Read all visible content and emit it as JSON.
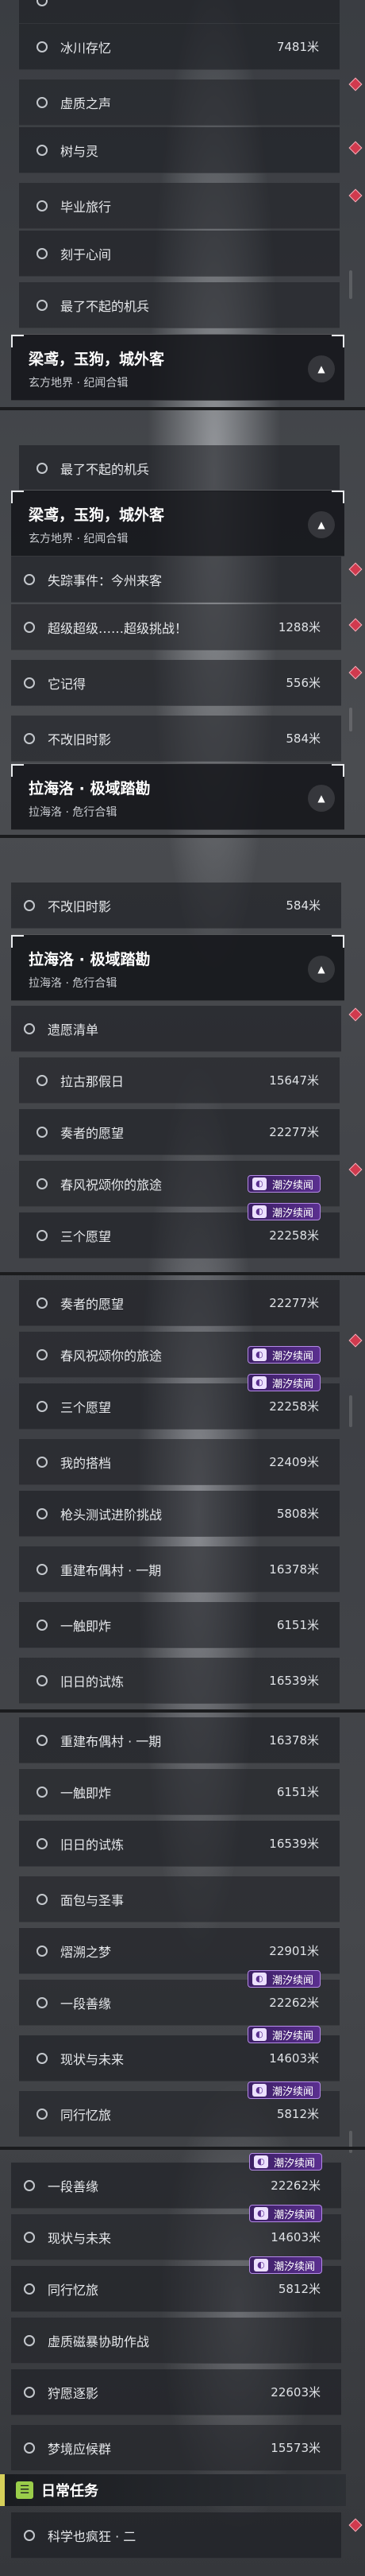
{
  "panels": [
    {
      "rows": [
        {
          "label": "",
          "circ": true,
          "dist": ""
        },
        {
          "label": "冰川存忆",
          "dist": "7481米"
        },
        {
          "label": "虚质之声",
          "dist": ""
        },
        {
          "label": "树与灵",
          "dist": ""
        },
        {
          "label": "毕业旅行",
          "dist": ""
        },
        {
          "label": "刻于心间",
          "dist": ""
        },
        {
          "label": "最了不起的机兵",
          "dist": ""
        }
      ],
      "header": {
        "title": "梁鸢，玉狗，城外客",
        "subtitle": "玄方地界 · 纪闻合辑"
      }
    },
    {
      "rows": [
        {
          "label": "最了不起的机兵",
          "dist": ""
        }
      ],
      "header": {
        "title": "梁鸢，玉狗，城外客",
        "subtitle": "玄方地界 · 纪闻合辑"
      },
      "rows2": [
        {
          "label": "失踪事件：今州来客",
          "dist": ""
        },
        {
          "label": "超级超级……超级挑战！",
          "dist": "1288米"
        },
        {
          "label": "它记得",
          "dist": "556米"
        },
        {
          "label": "不改旧时影",
          "dist": "584米"
        }
      ],
      "header2": {
        "title": "拉海洛 · 极域踏勘",
        "subtitle": "拉海洛 · 危行合辑"
      }
    },
    {
      "rows": [
        {
          "label": "不改旧时影",
          "dist": "584米"
        }
      ],
      "header": {
        "title": "拉海洛 · 极域踏勘",
        "subtitle": "拉海洛 · 危行合辑"
      },
      "rows2": [
        {
          "label": "遗愿清单",
          "dist": ""
        },
        {
          "label": "拉古那假日",
          "dist": "15647米"
        },
        {
          "label": "奏者的愿望",
          "dist": "22277米"
        },
        {
          "label": "春风祝颂你的旅途",
          "dist": ""
        },
        {
          "label": "三个愿望",
          "dist": "22258米"
        }
      ]
    },
    {
      "rows": [
        {
          "label": "奏者的愿望",
          "dist": "22277米"
        },
        {
          "label": "春风祝颂你的旅途",
          "dist": ""
        },
        {
          "label": "三个愿望",
          "dist": "22258米"
        },
        {
          "label": "我的搭档",
          "dist": "22409米"
        },
        {
          "label": "枪头测试进阶挑战",
          "dist": "5808米"
        },
        {
          "label": "重建布偶村 · 一期",
          "dist": "16378米"
        },
        {
          "label": "一触即炸",
          "dist": "6151米"
        },
        {
          "label": "旧日的试炼",
          "dist": "16539米"
        }
      ]
    },
    {
      "rows": [
        {
          "label": "重建布偶村 · 一期",
          "dist": "16378米"
        },
        {
          "label": "一触即炸",
          "dist": "6151米"
        },
        {
          "label": "旧日的试炼",
          "dist": "16539米"
        },
        {
          "label": "面包与圣事",
          "dist": ""
        },
        {
          "label": "熠溯之梦",
          "dist": "22901米"
        },
        {
          "label": "一段善缘",
          "dist": "22262米"
        },
        {
          "label": "现状与未来",
          "dist": "14603米"
        },
        {
          "label": "同行忆旅",
          "dist": "5812米"
        }
      ]
    },
    {
      "rows": [
        {
          "label": "一段善缘",
          "dist": "22262米"
        },
        {
          "label": "现状与未来",
          "dist": "14603米"
        },
        {
          "label": "同行忆旅",
          "dist": "5812米"
        },
        {
          "label": "虚质磁暴协助作战",
          "dist": ""
        },
        {
          "label": "狩愿逐影",
          "dist": "22603米"
        },
        {
          "label": "梦境应候群",
          "dist": "15573米"
        }
      ],
      "daily": {
        "title": "日常任务",
        "icon": "task-icon"
      },
      "rows2": [
        {
          "label": "科学也疯狂 · 二",
          "dist": ""
        }
      ]
    }
  ],
  "badge_label": "潮汐续闻",
  "badge_icon": "tide-icon",
  "colors": {
    "accent_red": "#d03a4e",
    "badge_purple": "#5a2f8f",
    "daily_green": "#9acd4a"
  }
}
